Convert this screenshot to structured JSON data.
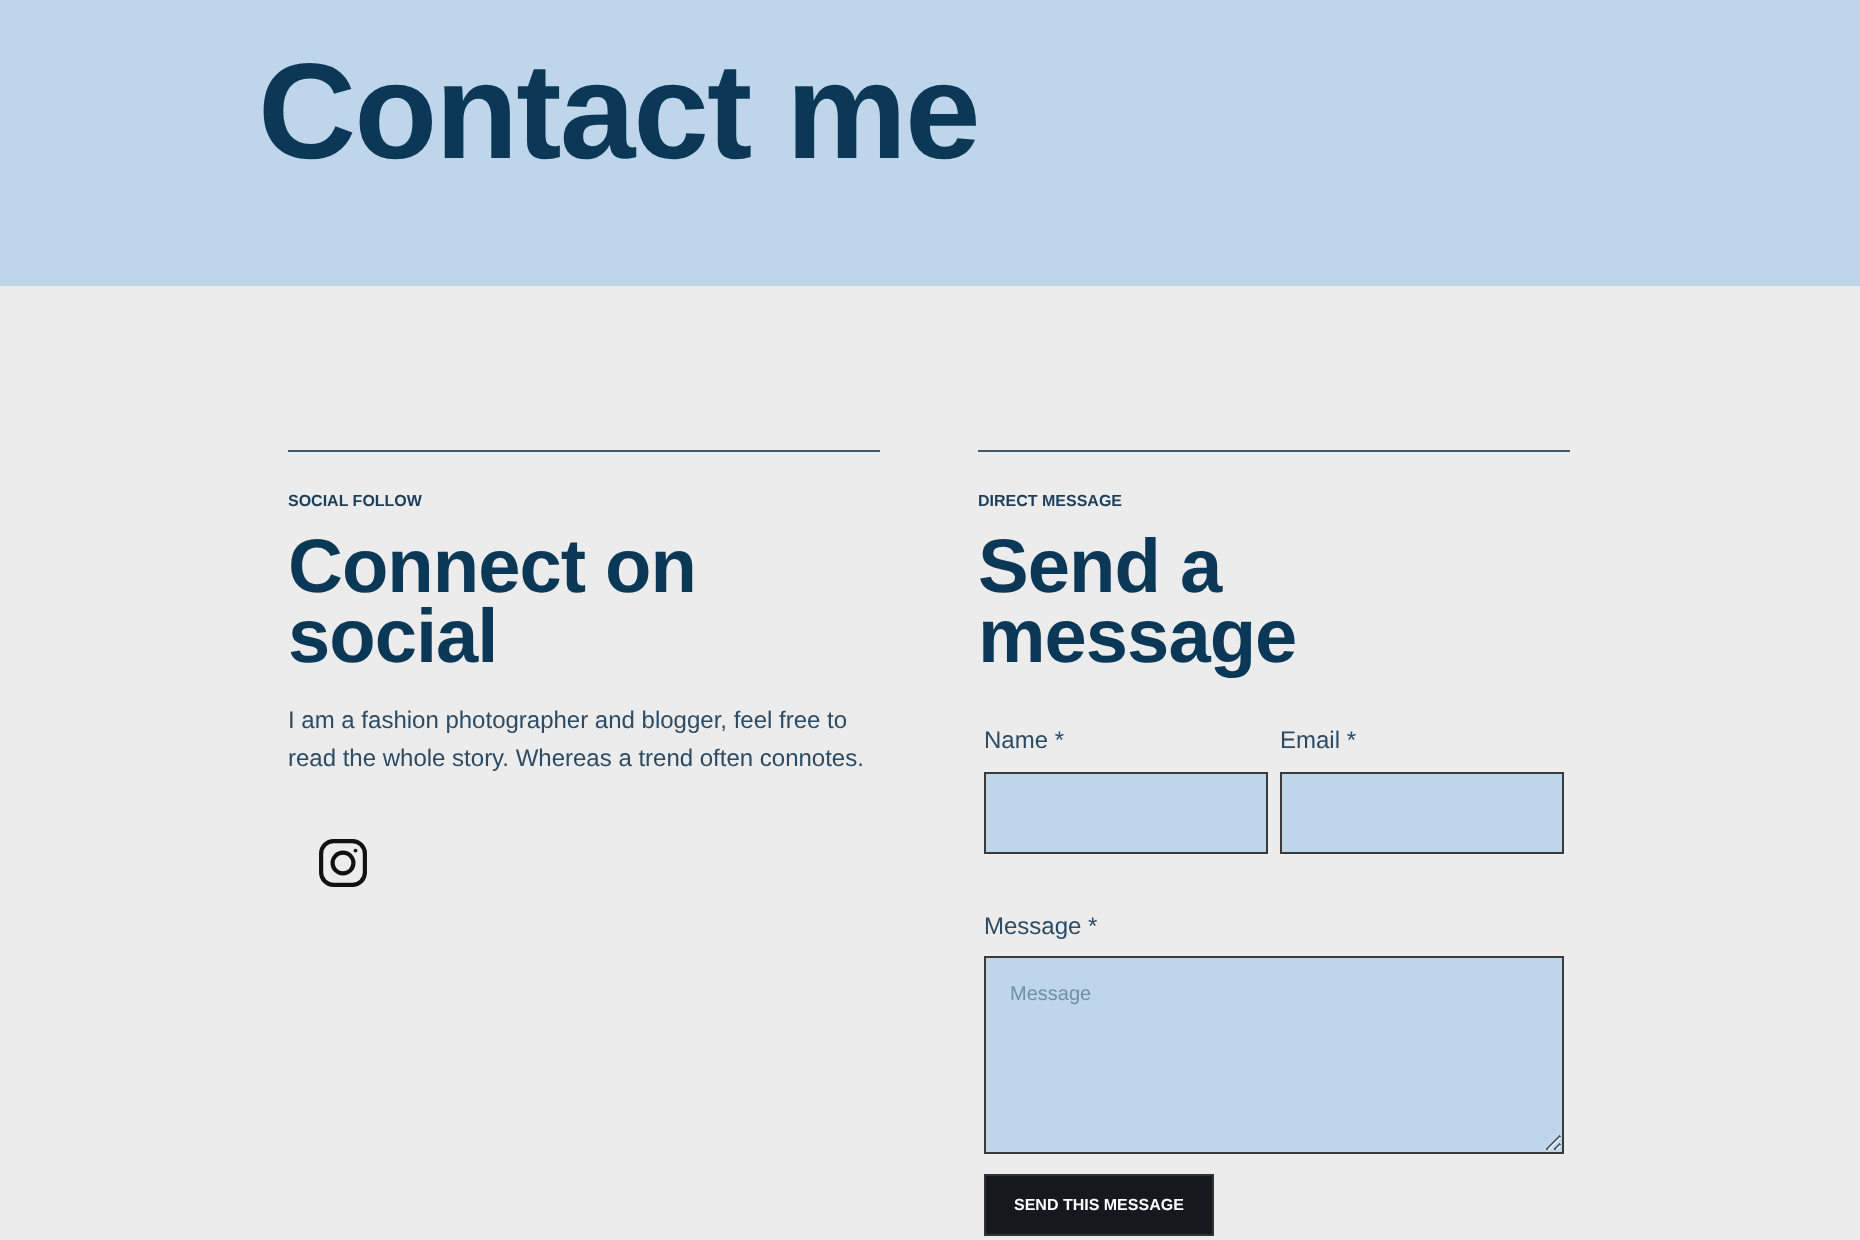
{
  "header": {
    "title": "Contact me"
  },
  "social": {
    "eyebrow": "SOCIAL FOLLOW",
    "heading": "Connect on social",
    "text": "I am a fashion photographer and blogger, feel free to read the whole story. Whereas a trend often connotes."
  },
  "form": {
    "eyebrow": "DIRECT MESSAGE",
    "heading": "Send a message",
    "fields": [
      {
        "kind": "input",
        "label": "Name *"
      },
      {
        "kind": "input",
        "label": "Email *"
      },
      {
        "kind": "textarea",
        "label": "Message *",
        "placeholder": "Message"
      }
    ],
    "button": "SEND THIS MESSAGE"
  }
}
